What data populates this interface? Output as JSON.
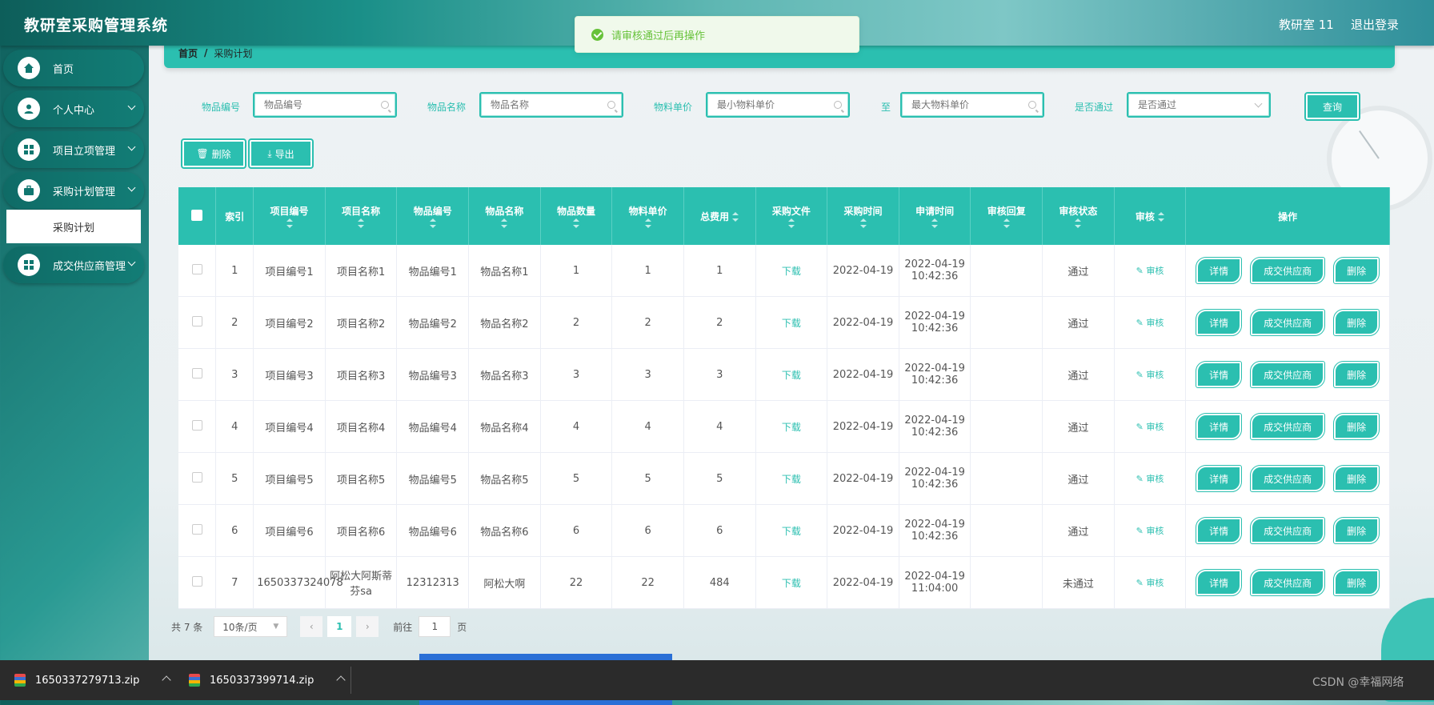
{
  "header": {
    "title": "教研室采购管理系统",
    "user": "教研室 11",
    "logout": "退出登录"
  },
  "toast": {
    "message": "请审核通过后再操作"
  },
  "sidebar": {
    "items": [
      {
        "label": "首页",
        "icon": "home-icon"
      },
      {
        "label": "个人中心",
        "icon": "user-icon"
      },
      {
        "label": "项目立项管理",
        "icon": "grid-icon"
      },
      {
        "label": "采购计划管理",
        "icon": "briefcase-icon"
      },
      {
        "label": "成交供应商管理",
        "icon": "grid-icon"
      }
    ],
    "submenu": {
      "label": "采购计划"
    }
  },
  "breadcrumb": {
    "home": "首页",
    "separator": "/",
    "current": "采购计划"
  },
  "filters": {
    "item_code": {
      "label": "物品编号",
      "placeholder": "物品编号"
    },
    "item_name": {
      "label": "物品名称",
      "placeholder": "物品名称"
    },
    "unit_price": {
      "label": "物料单价",
      "min_placeholder": "最小物料单价",
      "to": "至",
      "max_placeholder": "最大物料单价"
    },
    "approved": {
      "label": "是否通过",
      "placeholder": "是否通过"
    },
    "query_button": "查询"
  },
  "actions": {
    "delete": "删除",
    "export": "导出"
  },
  "table": {
    "columns": [
      "索引",
      "项目编号",
      "项目名称",
      "物品编号",
      "物品名称",
      "物品数量",
      "物料单价",
      "总费用",
      "采购文件",
      "采购时间",
      "申请时间",
      "审核回复",
      "审核状态",
      "审核",
      "操作"
    ],
    "download_label": "下载",
    "audit_label": "审核",
    "op_labels": {
      "detail": "详情",
      "supplier": "成交供应商",
      "delete": "删除"
    },
    "rows": [
      {
        "idx": "1",
        "proj_code": "项目编号1",
        "proj_name": "项目名称1",
        "item_code": "物品编号1",
        "item_name": "物品名称1",
        "qty": "1",
        "price": "1",
        "total": "1",
        "buy_time": "2022-04-19",
        "apply_time": "2022-04-19 10:42:36",
        "reply": "",
        "status": "通过"
      },
      {
        "idx": "2",
        "proj_code": "项目编号2",
        "proj_name": "项目名称2",
        "item_code": "物品编号2",
        "item_name": "物品名称2",
        "qty": "2",
        "price": "2",
        "total": "2",
        "buy_time": "2022-04-19",
        "apply_time": "2022-04-19 10:42:36",
        "reply": "",
        "status": "通过"
      },
      {
        "idx": "3",
        "proj_code": "项目编号3",
        "proj_name": "项目名称3",
        "item_code": "物品编号3",
        "item_name": "物品名称3",
        "qty": "3",
        "price": "3",
        "total": "3",
        "buy_time": "2022-04-19",
        "apply_time": "2022-04-19 10:42:36",
        "reply": "",
        "status": "通过"
      },
      {
        "idx": "4",
        "proj_code": "项目编号4",
        "proj_name": "项目名称4",
        "item_code": "物品编号4",
        "item_name": "物品名称4",
        "qty": "4",
        "price": "4",
        "total": "4",
        "buy_time": "2022-04-19",
        "apply_time": "2022-04-19 10:42:36",
        "reply": "",
        "status": "通过"
      },
      {
        "idx": "5",
        "proj_code": "项目编号5",
        "proj_name": "项目名称5",
        "item_code": "物品编号5",
        "item_name": "物品名称5",
        "qty": "5",
        "price": "5",
        "total": "5",
        "buy_time": "2022-04-19",
        "apply_time": "2022-04-19 10:42:36",
        "reply": "",
        "status": "通过"
      },
      {
        "idx": "6",
        "proj_code": "项目编号6",
        "proj_name": "项目名称6",
        "item_code": "物品编号6",
        "item_name": "物品名称6",
        "qty": "6",
        "price": "6",
        "total": "6",
        "buy_time": "2022-04-19",
        "apply_time": "2022-04-19 10:42:36",
        "reply": "",
        "status": "通过"
      },
      {
        "idx": "7",
        "proj_code": "1650337324078",
        "proj_name": "阿松大阿斯蒂芬sa",
        "item_code": "12312313",
        "item_name": "阿松大啊",
        "qty": "22",
        "price": "22",
        "total": "484",
        "buy_time": "2022-04-19",
        "apply_time": "2022-04-19 11:04:00",
        "reply": "",
        "status": "未通过"
      }
    ]
  },
  "pagination": {
    "total": "共 7 条",
    "page_size": "10条/页",
    "current_page": "1",
    "goto_label": "前往",
    "goto_value": "1",
    "page_suffix": "页"
  },
  "downloads": [
    {
      "file": "1650337279713.zip"
    },
    {
      "file": "1650337399714.zip"
    }
  ],
  "watermark": "CSDN @幸福网络",
  "colors": {
    "accent": "#2bbfb0",
    "sidebar": "#0f6b66",
    "toast_success": "#67c23a"
  }
}
